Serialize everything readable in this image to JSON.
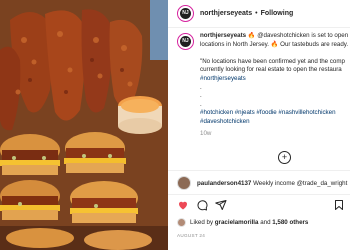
{
  "post": {
    "username": "northjerseyeats",
    "follow_separator": "•",
    "follow_label": "Following",
    "avatar_initials": "NJ"
  },
  "caption": {
    "username": "northjerseyeats",
    "line1_text": "🔥 @daveshotchicken is set to open",
    "line2_text": "locations in North Jersey. 🔥 Our tastebuds are ready.",
    "line3_text": "\"No locations have been confirmed yet and the comp",
    "line4_text": "currently looking for real estate to open the restaura",
    "line5_text": "#northjerseyeats",
    "dot1": ".",
    "dot2": ".",
    "dot3": ".",
    "hashtags": "#hotchicken #njeats #foodie #nashvillehotchicken",
    "hashtags2": "#daveshotchicken",
    "age": "10w"
  },
  "load_more": {
    "icon": "plus-circle-icon",
    "label": "+"
  },
  "comment": {
    "username": "paulanderson4137",
    "text": "Weekly income @trade_da_wright"
  },
  "actions": {
    "icons": [
      "heart-icon",
      "comment-icon",
      "share-icon",
      "bookmark-icon"
    ]
  },
  "likes": {
    "prefix": "Liked by",
    "user": "gracielamorilla",
    "connector": "and",
    "others": "1,580 others"
  },
  "date": "AUGUST 24",
  "colors": {
    "link": "#00376b",
    "muted": "#8e8e8e",
    "ring": "#d6249f",
    "chicken": "#9c3f18",
    "bun": "#e0a04a"
  }
}
